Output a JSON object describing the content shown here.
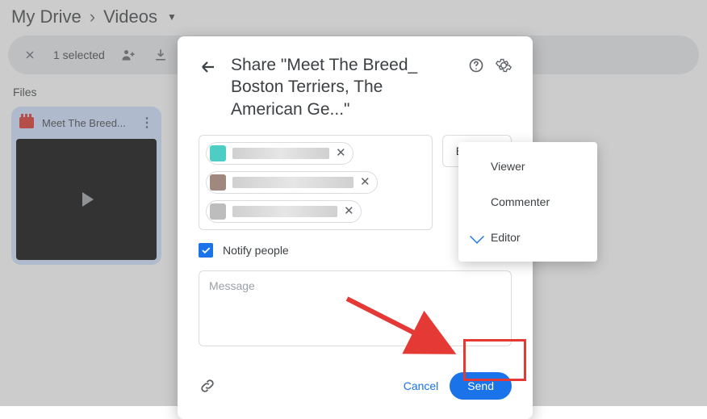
{
  "breadcrumb": {
    "root": "My Drive",
    "folder": "Videos"
  },
  "selection_bar": {
    "close": "✕",
    "count": "1 selected"
  },
  "files_heading": "Files",
  "thumbnail": {
    "title": "Meet The Breed..."
  },
  "dialog": {
    "title": "Share \"Meet The Breed_ Boston Terriers, The American Ge...\"",
    "role_button": "Editor",
    "notify_label": "Notify people",
    "message_placeholder": "Message",
    "cancel": "Cancel",
    "send": "Send"
  },
  "role_menu": {
    "viewer": "Viewer",
    "commenter": "Commenter",
    "editor": "Editor"
  }
}
